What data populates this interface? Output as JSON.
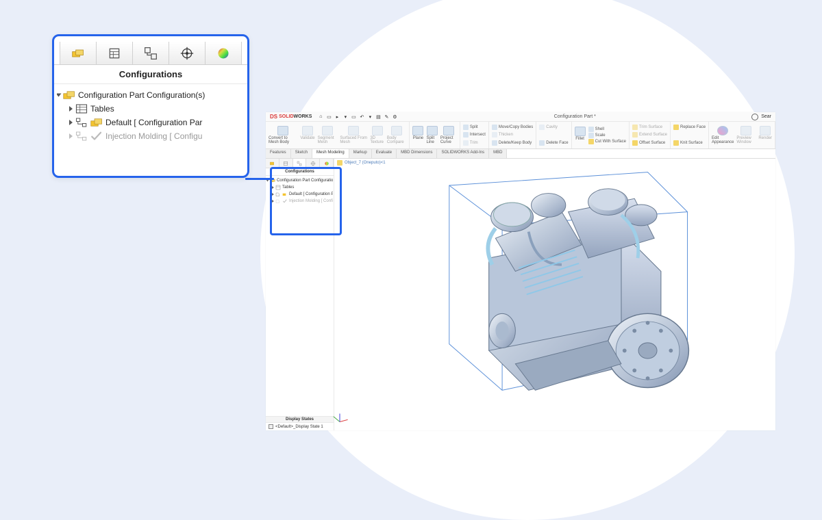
{
  "callout": {
    "title": "Configurations",
    "root": "Configuration Part Configuration(s)",
    "items": [
      {
        "label": "Tables"
      },
      {
        "label": "Default [ Configuration Par"
      },
      {
        "label": "Injection Molding [ Configu"
      }
    ]
  },
  "app": {
    "brand_pre": "S",
    "brand_mid": "OLID",
    "brand_post": "WORKS",
    "title": "Configuration Part *",
    "search_label": "Sear",
    "ribbon": {
      "convert": "Convert to Mesh Body",
      "validate": "Validate",
      "segment": "Segment Mesh",
      "surfaced": "Surfaced From Mesh",
      "3dtex": "3D Texture",
      "bodycmp": "Body Compare",
      "plane": "Plane",
      "split": "Split Line",
      "project": "Project Curve",
      "split2": "Split",
      "intersect": "Intersect",
      "trim": "Trim",
      "cavity": "Cavity",
      "movecopy": "Move/Copy Bodies",
      "thicken": "Thicken",
      "delkeep": "Delete/Keep Body",
      "delface": "Delete Face",
      "fillet": "Fillet",
      "shell": "Shell",
      "scale": "Scale",
      "cutsurf": "Cut With Surface",
      "trimsurf": "Trim Surface",
      "extendsurf": "Extend Surface",
      "offsetsurf": "Offset Surface",
      "knitsurf": "Knit Surface",
      "replface": "Replace Face",
      "editapp": "Edit Appearance",
      "preview": "Preview Window",
      "render": "Render"
    },
    "tabs": [
      "Features",
      "Sketch",
      "Mesh Modeling",
      "Markup",
      "Evaluate",
      "MBD Dimensions",
      "SOLIDWORKS Add-Ins",
      "MBD"
    ],
    "active_tab": 2,
    "breadcrumb": "Object_7 (Oneputo)<1",
    "side": {
      "title": "Configurations",
      "root": "Configuration Part Configuration(s)",
      "items": [
        "Tables",
        "Default [ Configuration Pa",
        "Injection Molding [ Config"
      ]
    },
    "display_states": {
      "header": "Display States",
      "item": "<Default>_Display State 1"
    }
  }
}
